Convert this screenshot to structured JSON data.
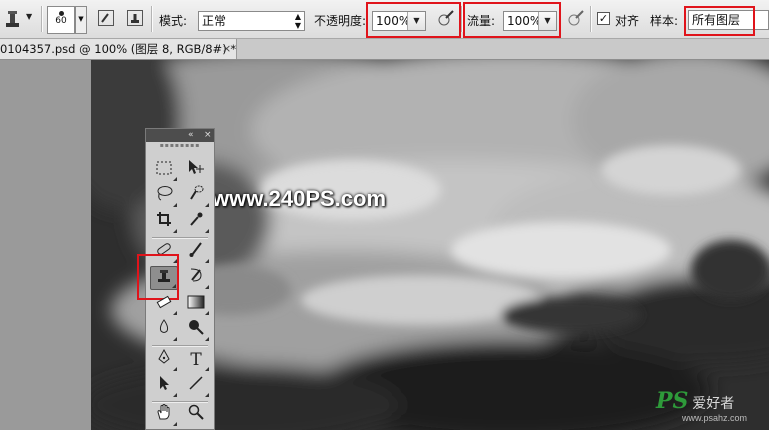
{
  "options_bar": {
    "brush_size": "60",
    "mode_label": "模式:",
    "mode_value": "正常",
    "opacity_label": "不透明度:",
    "opacity_value": "100%",
    "flow_label": "流量:",
    "flow_value": "100%",
    "aligned_label": "对齐",
    "aligned_checked": true,
    "sample_label": "样本:",
    "sample_value": "所有图层"
  },
  "document_tab": {
    "title": "0104357.psd @ 100% (图层 8, RGB/8#) *",
    "close": "×"
  },
  "toolbox": {
    "collapse": "«",
    "close": "×"
  },
  "watermarks": {
    "center": "www.240PS.com",
    "brand_big": "PS",
    "brand_cn": "爱好者",
    "brand_url": "www.psahz.com"
  },
  "highlight_color": "#e0141b",
  "watermark_brand_color": "#2e9a3a"
}
